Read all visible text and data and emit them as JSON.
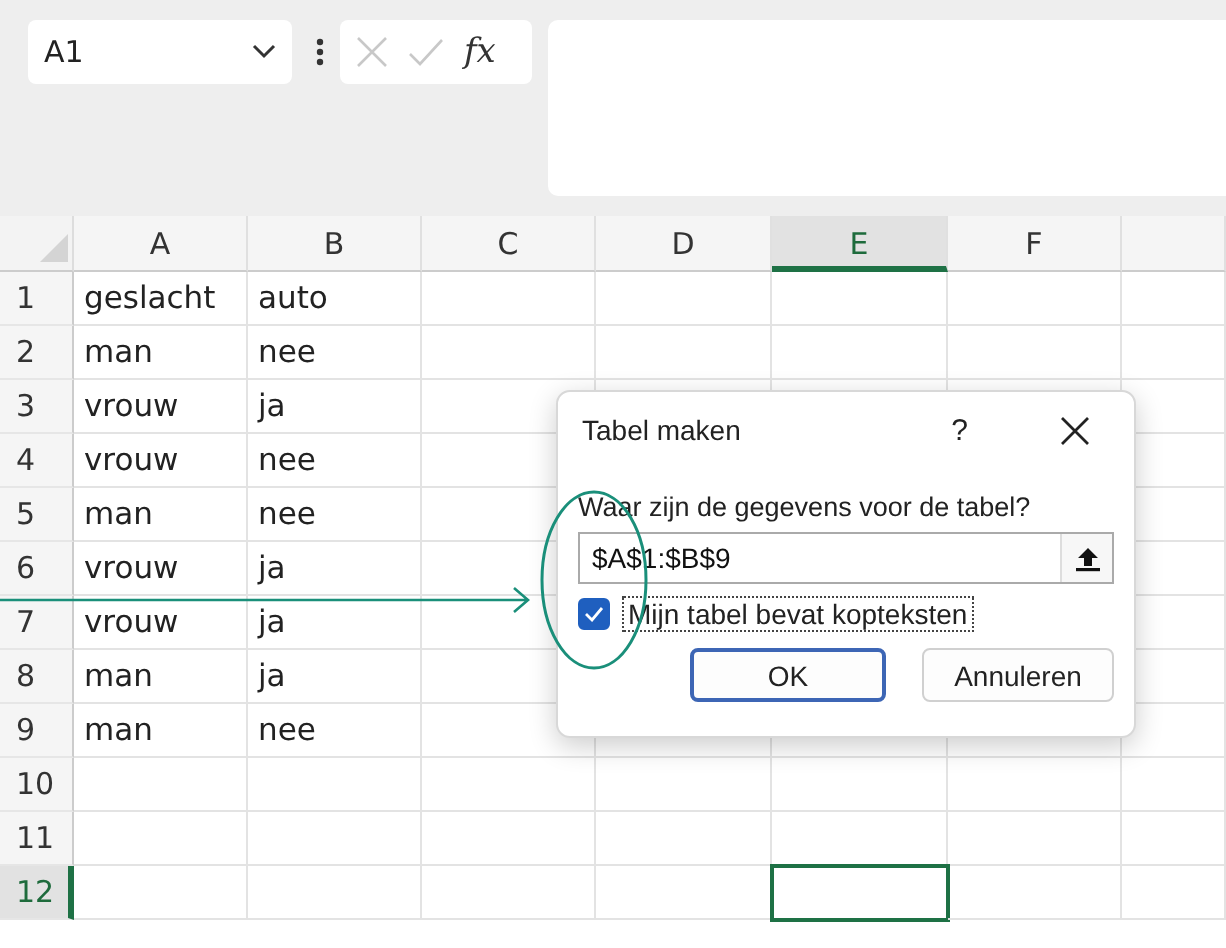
{
  "formula_bar": {
    "name_box": "A1",
    "function_label": "fx"
  },
  "sheet": {
    "columns": [
      {
        "label": "A",
        "selected": false
      },
      {
        "label": "B",
        "selected": false
      },
      {
        "label": "C",
        "selected": false
      },
      {
        "label": "D",
        "selected": false
      },
      {
        "label": "E",
        "selected": true
      },
      {
        "label": "F",
        "selected": false
      }
    ],
    "rows": [
      {
        "number": "1",
        "selected": false,
        "cells": [
          "geslacht",
          "auto"
        ]
      },
      {
        "number": "2",
        "selected": false,
        "cells": [
          "man",
          "nee"
        ]
      },
      {
        "number": "3",
        "selected": false,
        "cells": [
          "vrouw",
          "ja"
        ]
      },
      {
        "number": "4",
        "selected": false,
        "cells": [
          "vrouw",
          "nee"
        ]
      },
      {
        "number": "5",
        "selected": false,
        "cells": [
          "man",
          "nee"
        ]
      },
      {
        "number": "6",
        "selected": false,
        "cells": [
          "vrouw",
          "ja"
        ]
      },
      {
        "number": "7",
        "selected": false,
        "cells": [
          "vrouw",
          "ja"
        ]
      },
      {
        "number": "8",
        "selected": false,
        "cells": [
          "man",
          "ja"
        ]
      },
      {
        "number": "9",
        "selected": false,
        "cells": [
          "man",
          "nee"
        ]
      },
      {
        "number": "10",
        "selected": false,
        "cells": []
      },
      {
        "number": "11",
        "selected": false,
        "cells": []
      },
      {
        "number": "12",
        "selected": true,
        "cells": []
      }
    ]
  },
  "dialog": {
    "title": "Tabel maken",
    "help": "?",
    "prompt": "Waar zijn de gegevens voor de tabel?",
    "range": "$A$1:$B$9",
    "checkbox": {
      "label": "Mijn tabel bevat kopteksten",
      "checked": true
    },
    "buttons": [
      {
        "label": "OK",
        "kind": "primary"
      },
      {
        "label": "Annuleren",
        "kind": "secondary"
      }
    ]
  }
}
